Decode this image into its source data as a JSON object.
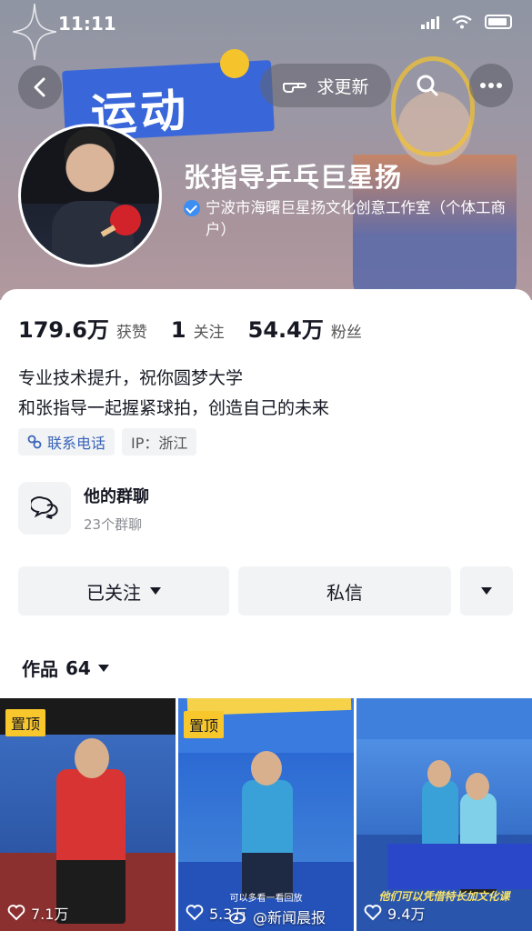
{
  "status_bar": {
    "time": "11:11"
  },
  "header": {
    "banner_text": "运动",
    "banner_sub": "",
    "request_update_label": "求更新",
    "display_name": "张指导乒乓巨星扬",
    "verification": "宁波市海曙巨星扬文化创意工作室（个体工商户）",
    "verify_color": "#3b8ef3"
  },
  "stats": {
    "likes_value": "179.6万",
    "likes_label": "获赞",
    "following_value": "1",
    "following_label": "关注",
    "followers_value": "54.4万",
    "followers_label": "粉丝"
  },
  "bio": {
    "line1": "专业技术提升，祝你圆梦大学",
    "line2": "和张指导一起握紧球拍，创造自己的未来"
  },
  "tags": {
    "phone_label": "联系电话",
    "ip_label": "IP：浙江"
  },
  "group_chat": {
    "title": "他的群聊",
    "subtitle": "23个群聊"
  },
  "actions": {
    "follow_label": "已关注",
    "message_label": "私信"
  },
  "works": {
    "label": "作品",
    "count": "64"
  },
  "videos": [
    {
      "pinned_label": "置顶",
      "likes": "7.1万"
    },
    {
      "pinned_label": "置顶",
      "likes": "5.3万",
      "caption": "可以多看一看回放"
    },
    {
      "likes": "9.4万",
      "caption": "他们可以凭借特长加文化课"
    }
  ],
  "watermark": "@新闻晨报",
  "colors": {
    "pin_bg": "#f8c72c",
    "link_blue": "#3a64b8"
  }
}
